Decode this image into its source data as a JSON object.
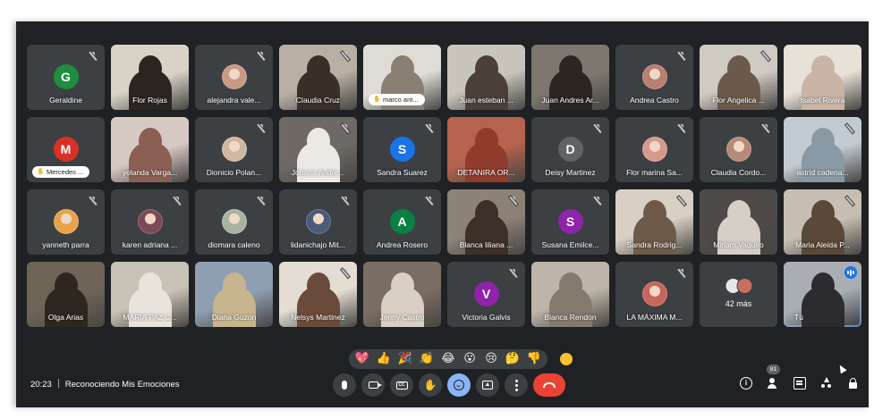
{
  "meeting": {
    "time": "20:23",
    "title": "Reconociendo Mis Emociones",
    "participant_count": "81"
  },
  "reactions": [
    "💖",
    "👍",
    "🎉",
    "👏",
    "😂",
    "😮",
    "😢",
    "🤔",
    "👎"
  ],
  "colors": {
    "background": "#202124",
    "tile": "#3c4043",
    "accent": "#8ab4f8",
    "end_call": "#ea4335"
  },
  "tiles": [
    {
      "name": "Geraldine",
      "type": "letter",
      "letter": "G",
      "color": "#1e8e3e",
      "muted": true
    },
    {
      "name": "Flor Rojas",
      "type": "video",
      "bg": "#d9d3c7",
      "person": "#2b2420",
      "muted": false
    },
    {
      "name": "alejandra vale...",
      "type": "photo",
      "color": "#c89a86",
      "muted": true
    },
    {
      "name": "Claudia Cruz",
      "type": "video",
      "bg": "#b8b0a4",
      "person": "#3a2e28",
      "muted": true
    },
    {
      "name": "marco ant...",
      "type": "video-pill",
      "bg": "#dfdcd6",
      "person": "#8a7f75",
      "muted": false
    },
    {
      "name": "Juan esteban ...",
      "type": "video",
      "bg": "#c9c4bc",
      "person": "#4b4038",
      "muted": false
    },
    {
      "name": "Juan Andres Ar...",
      "type": "video",
      "bg": "#7d7770",
      "person": "#2c2622",
      "muted": false
    },
    {
      "name": "Andrea Castro",
      "type": "photo",
      "color": "#b97f6f",
      "muted": true
    },
    {
      "name": "Flor Angelica ...",
      "type": "video",
      "bg": "#cfcac2",
      "person": "#6b5a4c",
      "muted": true
    },
    {
      "name": "Isabel Rivera",
      "type": "video",
      "bg": "#e8e1d8",
      "person": "#c9b4a6",
      "muted": false
    },
    {
      "name": "Mercedes ...",
      "type": "letter-pill",
      "letter": "M",
      "color": "#d93025",
      "muted": false
    },
    {
      "name": "yolanda Varga...",
      "type": "video",
      "bg": "#d6c9c3",
      "person": "#8c5f55",
      "muted": false
    },
    {
      "name": "Dionicio Polan...",
      "type": "photo",
      "color": "#d0b7a2",
      "muted": true
    },
    {
      "name": "Johana Andre...",
      "type": "video",
      "bg": "#6e6965",
      "person": "#ece9e4",
      "muted": true
    },
    {
      "name": "Sandra Suarez",
      "type": "letter",
      "letter": "S",
      "color": "#1a73e8",
      "muted": true
    },
    {
      "name": "DETANIRA OR...",
      "type": "video",
      "bg": "#b5624e",
      "person": "#8f3c2d",
      "muted": false
    },
    {
      "name": "Deisy Martinez",
      "type": "letter",
      "letter": "D",
      "color": "#5f6368",
      "muted": true
    },
    {
      "name": "Flor marina Sa...",
      "type": "photo",
      "color": "#d69a8d",
      "muted": true
    },
    {
      "name": "Claudia Cordo...",
      "type": "photo",
      "color": "#b58a76",
      "muted": true
    },
    {
      "name": "astrid cadena...",
      "type": "video",
      "bg": "#c3cbd2",
      "person": "#8a9aa5",
      "muted": true
    },
    {
      "name": "yanneth parra",
      "type": "photo",
      "color": "#e8a34a",
      "muted": true
    },
    {
      "name": "karen adriana ...",
      "type": "photo",
      "color": "#7a4a56",
      "muted": true
    },
    {
      "name": "diomara caleno",
      "type": "photo",
      "color": "#a8b4a0",
      "muted": true
    },
    {
      "name": "lidanichajo Mit...",
      "type": "photo",
      "color": "#4a5a7a",
      "muted": true
    },
    {
      "name": "Andrea Rosero",
      "type": "letter",
      "letter": "A",
      "color": "#0b8043",
      "muted": true
    },
    {
      "name": "Blanca liliana ...",
      "type": "video",
      "bg": "#8c8278",
      "person": "#3d3028",
      "muted": true
    },
    {
      "name": "Susana Emilce...",
      "type": "letter",
      "letter": "S",
      "color": "#8e24aa",
      "muted": true
    },
    {
      "name": "Sandra Rodrig...",
      "type": "video",
      "bg": "#d8d0c4",
      "person": "#6e5a48",
      "muted": true
    },
    {
      "name": "Mirlam Vaquiro",
      "type": "video",
      "bg": "#4e4a47",
      "person": "#d5cfc8",
      "muted": false
    },
    {
      "name": "Maria Aleida P...",
      "type": "video",
      "bg": "#c7bfb3",
      "person": "#5a4838",
      "muted": true
    },
    {
      "name": "Olga Arias",
      "type": "video",
      "bg": "#6e6558",
      "person": "#2e2720",
      "muted": false
    },
    {
      "name": "MARIA PAZ C...",
      "type": "video",
      "bg": "#c9c2b6",
      "person": "#e8e4dc",
      "muted": false
    },
    {
      "name": "Diana Guzon",
      "type": "video",
      "bg": "#8f9fb2",
      "person": "#c8b48e",
      "muted": false
    },
    {
      "name": "Nelsys Martinez",
      "type": "video",
      "bg": "#e3ddd3",
      "person": "#6a4b3b",
      "muted": true
    },
    {
      "name": "Jenny Castro",
      "type": "video",
      "bg": "#7a6e64",
      "person": "#d9cfc4",
      "muted": false
    },
    {
      "name": "Victoria Galvis",
      "type": "letter",
      "letter": "V",
      "color": "#8e24aa",
      "muted": true
    },
    {
      "name": "Blanca Rendon",
      "type": "video",
      "bg": "#bdb5a9",
      "person": "#857a6e",
      "muted": false
    },
    {
      "name": "LA MÁXIMA M...",
      "type": "photo",
      "color": "#c9655c",
      "muted": true
    },
    {
      "name": "42 más",
      "type": "more",
      "muted": false
    },
    {
      "name": "Tú",
      "type": "self",
      "bg": "#a9aeb2",
      "person": "#2c2c30",
      "muted": false
    }
  ]
}
